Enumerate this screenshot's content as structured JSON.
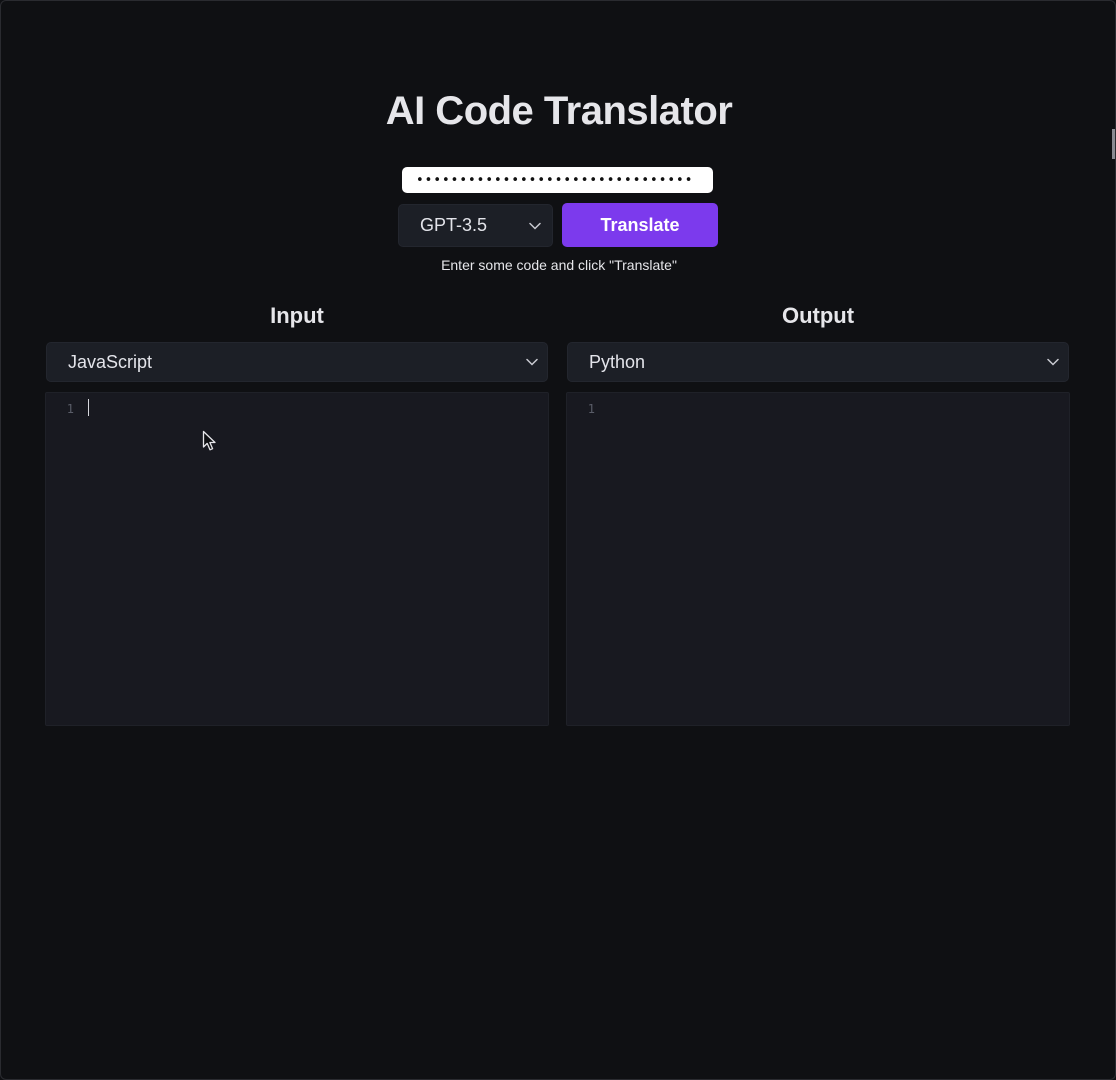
{
  "app": {
    "title": "AI Code Translator"
  },
  "api_key": {
    "value": "••••••••••••••••••••••••••••••••"
  },
  "model": {
    "selected": "GPT-3.5"
  },
  "translate": {
    "label": "Translate",
    "hint": "Enter some code and click \"Translate\""
  },
  "input_panel": {
    "heading": "Input",
    "language": "JavaScript",
    "line_numbers": [
      "1"
    ]
  },
  "output_panel": {
    "heading": "Output",
    "language": "Python",
    "line_numbers": [
      "1"
    ]
  },
  "colors": {
    "background": "#0f1013",
    "panel": "#1c1f26",
    "editor": "#181920",
    "accent": "#7c3aed",
    "text": "#e6e6ea"
  },
  "icons": {
    "select_arrow": "chevron-down-icon",
    "pointer": "mouse-pointer-icon"
  }
}
